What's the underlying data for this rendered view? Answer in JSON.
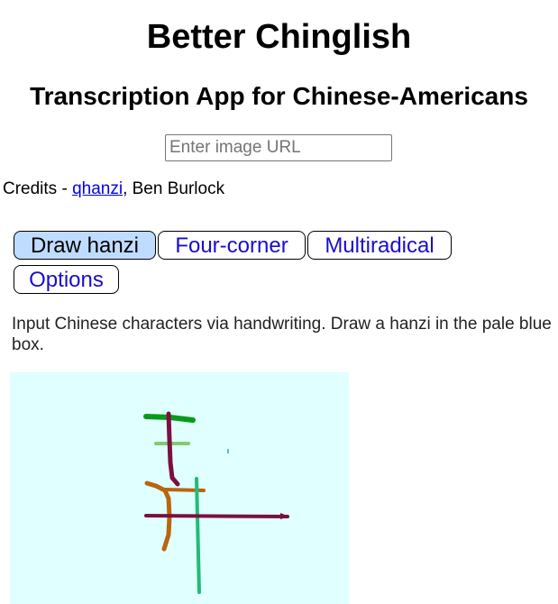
{
  "header": {
    "title": "Better Chinglish",
    "subtitle": "Transcription App for Chinese-Americans"
  },
  "url_input": {
    "placeholder": "Enter image URL",
    "value": ""
  },
  "credits": {
    "prefix": "Credits - ",
    "link_text": "qhanzi",
    "suffix": ", Ben Burlock"
  },
  "tabs": [
    {
      "label": "Draw hanzi",
      "active": true
    },
    {
      "label": "Four-corner",
      "active": false
    },
    {
      "label": "Multiradical",
      "active": false
    },
    {
      "label": "Options",
      "active": false
    }
  ],
  "description": "Input Chinese characters via handwriting. Draw a hanzi in the pale blue box.",
  "drawing_canvas": {
    "background": "#e0ffff",
    "stroke_colors": [
      "#0a9a1a",
      "#7fcc6f",
      "#7d0f3f",
      "#b8660f",
      "#22bb77",
      "#7d0f3f"
    ]
  }
}
